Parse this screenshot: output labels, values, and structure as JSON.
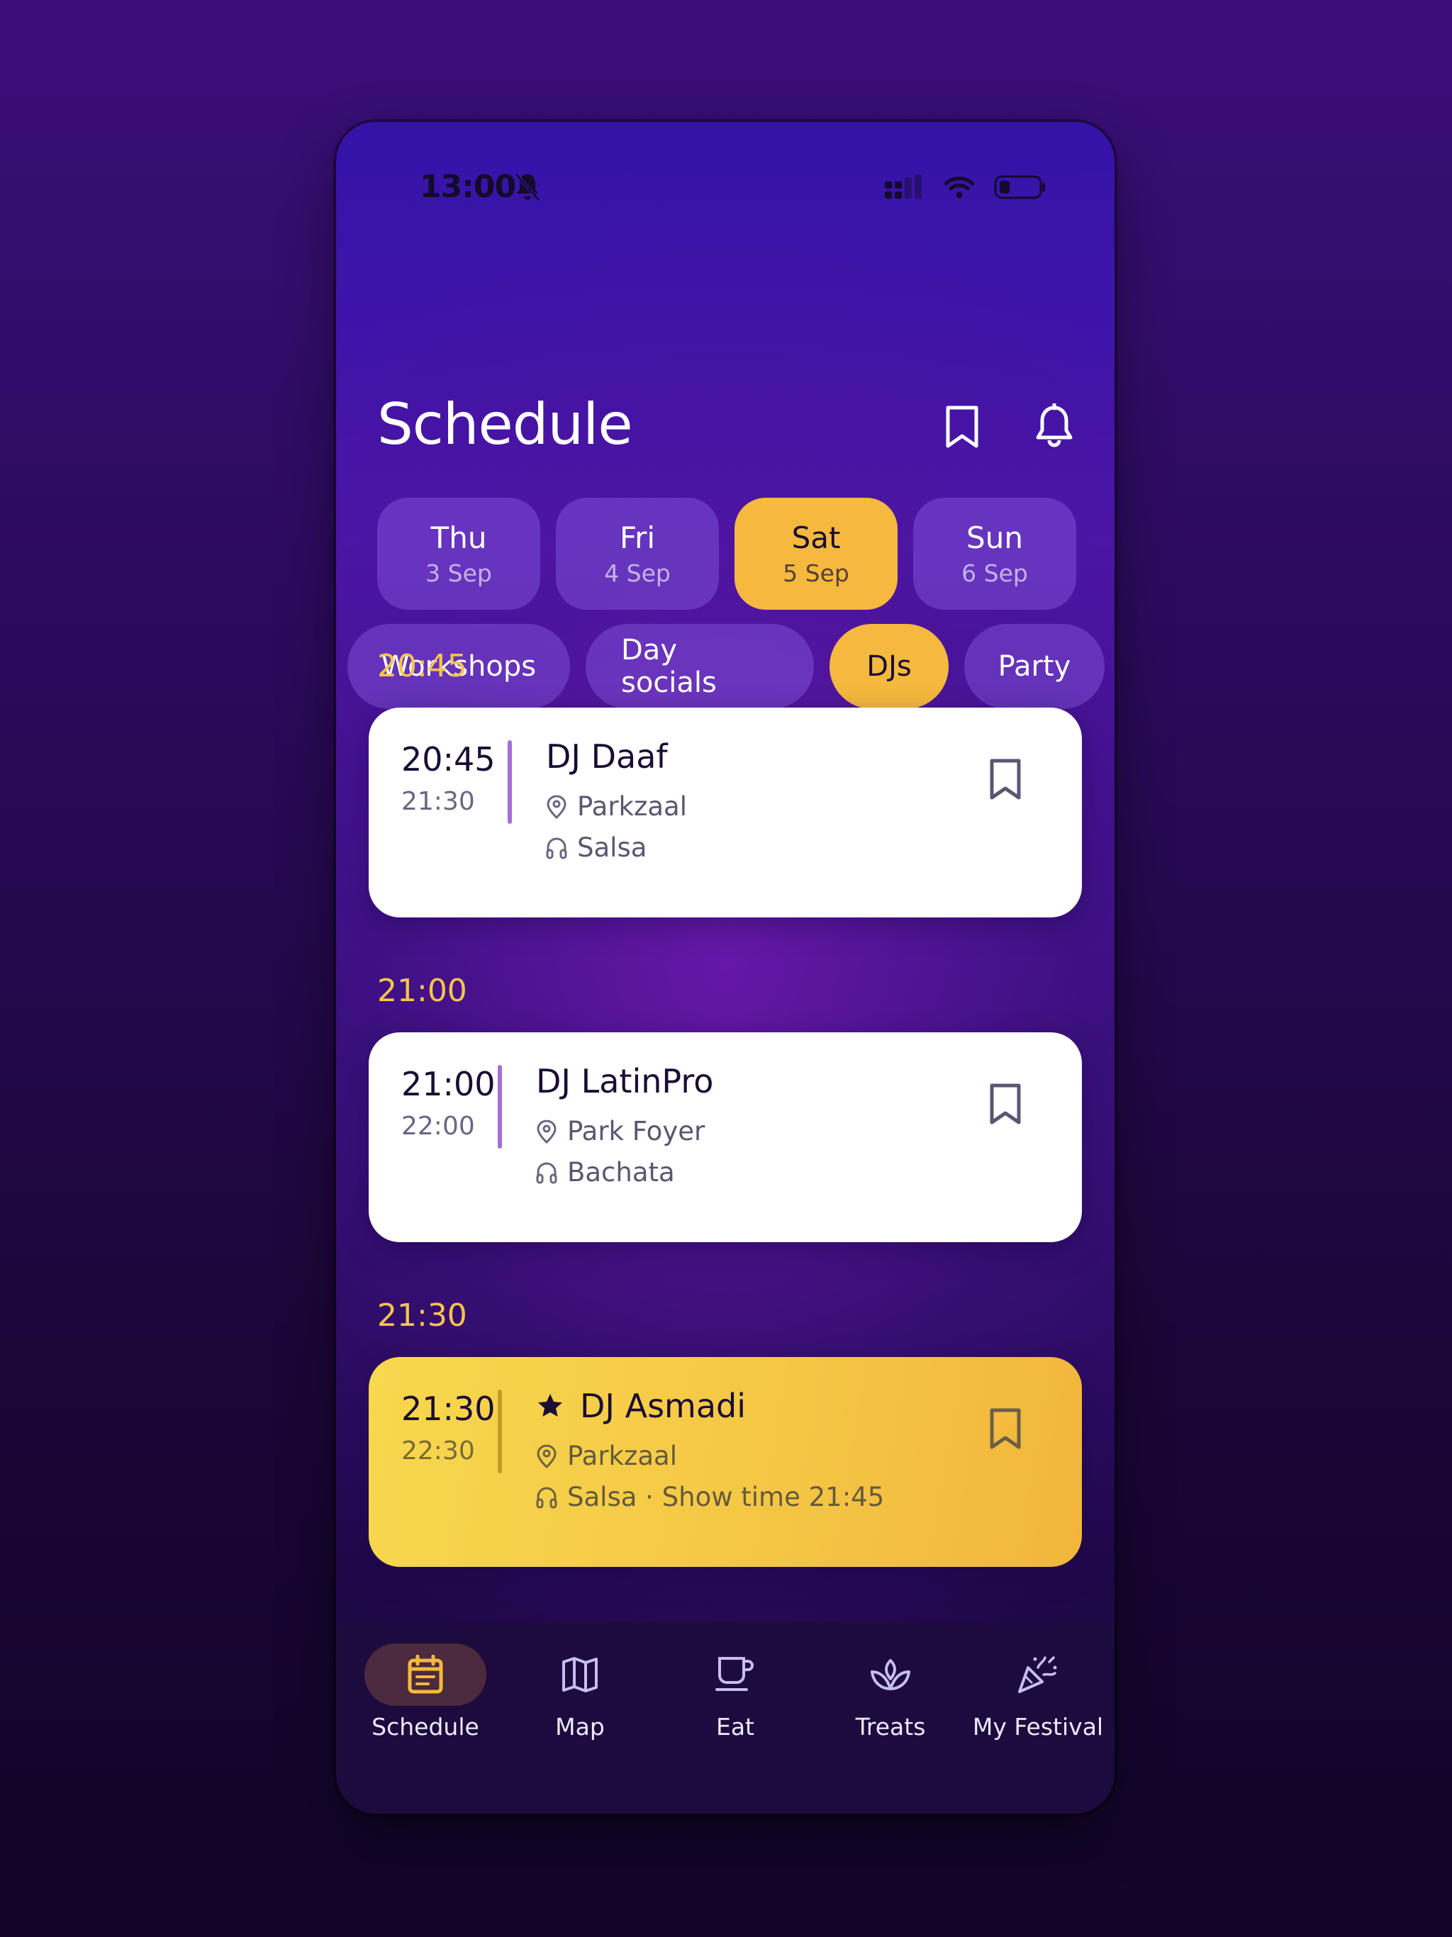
{
  "status": {
    "time": "13:00"
  },
  "header": {
    "title": "Schedule"
  },
  "days": [
    {
      "name": "Thu",
      "date": "3 Sep"
    },
    {
      "name": "Fri",
      "date": "4 Sep"
    },
    {
      "name": "Sat",
      "date": "5 Sep",
      "active": true
    },
    {
      "name": "Sun",
      "date": "6 Sep"
    }
  ],
  "filters": [
    {
      "label": "Workshops"
    },
    {
      "label": "Day socials"
    },
    {
      "label": "DJs",
      "active": true
    },
    {
      "label": "Party"
    }
  ],
  "events": [
    {
      "heading": "20:45",
      "start": "20:45",
      "end": "21:30",
      "title": "DJ Daaf",
      "location": "Parkzaal",
      "genre": "Salsa",
      "featured": false
    },
    {
      "heading": "21:00",
      "start": "21:00",
      "end": "22:00",
      "title": "DJ LatinPro",
      "location": "Park Foyer",
      "genre": "Bachata",
      "featured": false
    },
    {
      "heading": "21:30",
      "start": "21:30",
      "end": "22:30",
      "title": "DJ Asmadi",
      "location": "Parkzaal",
      "genre": "Salsa · Show time 21:45",
      "featured": true
    }
  ],
  "nav": [
    {
      "label": "Schedule",
      "icon": "calendar-icon",
      "active": true
    },
    {
      "label": "Map",
      "icon": "map-icon"
    },
    {
      "label": "Eat",
      "icon": "cup-icon"
    },
    {
      "label": "Treats",
      "icon": "lotus-icon"
    },
    {
      "label": "My Festival",
      "icon": "party-popper-icon"
    }
  ],
  "colors": {
    "accent": "#f4b93e",
    "heading": "#f6c54b",
    "card": "#ffffff",
    "nav_bg": "#1c0b3c"
  }
}
